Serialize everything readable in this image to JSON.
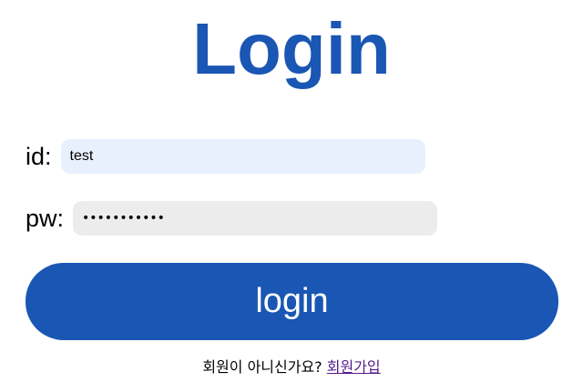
{
  "header": {
    "title": "Login"
  },
  "form": {
    "id_label": "id:",
    "id_value": "test",
    "pw_label": "pw:",
    "pw_value": "•••••••••••",
    "submit_label": "login"
  },
  "footer": {
    "prompt_text": "회원이 아니신가요?",
    "signup_link": "회원가입"
  },
  "colors": {
    "brand": "#1a56b3",
    "id_field_bg": "#e8f0fe",
    "pw_field_bg": "#ececec",
    "visited_link": "#551a8b"
  }
}
